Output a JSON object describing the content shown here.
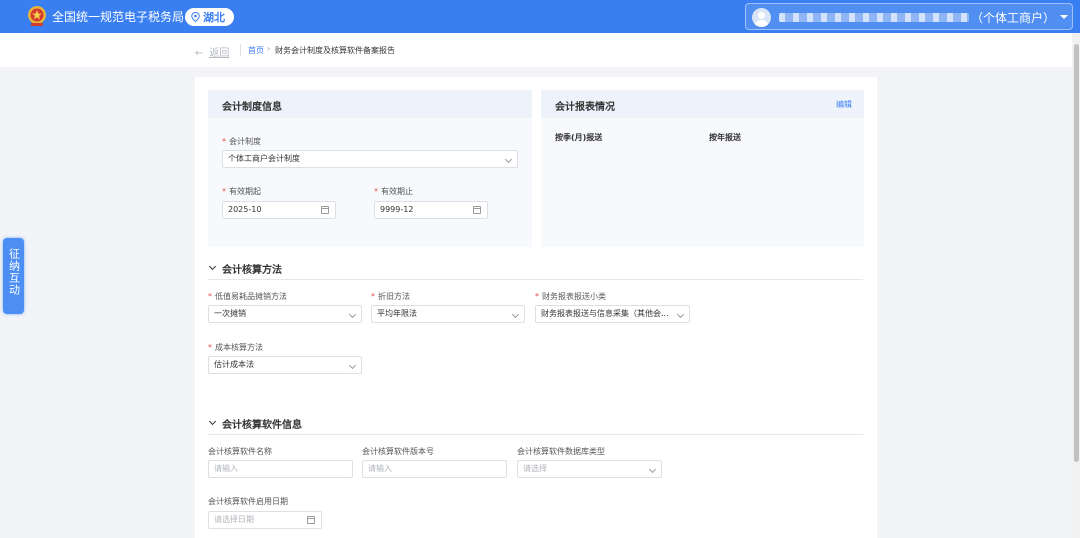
{
  "header": {
    "site_title": "全国统一规范电子税务局",
    "region": "湖北",
    "user_type": "（个体工商户）",
    "icons": [
      "emblem-logo",
      "location-pin-icon",
      "user-avatar-icon",
      "caret-down-icon"
    ]
  },
  "breadcrumb": {
    "back_label": "返回",
    "home": "首页",
    "separator": "›",
    "current": "财务会计制度及核算软件备案报告"
  },
  "float_tab": {
    "label": "征纳互动"
  },
  "accounting_system": {
    "title": "会计制度信息",
    "system_label": "会计制度",
    "system_value": "个体工商户会计制度",
    "start_label": "有效期起",
    "start_value": "2025-10",
    "end_label": "有效期止",
    "end_value": "9999-12"
  },
  "report_status": {
    "title": "会计报表情况",
    "edit_label": "编辑",
    "col_monthly": "按季(月)报送",
    "col_yearly": "按年报送"
  },
  "accounting_method": {
    "title": "会计核算方法",
    "low_value_label": "低值易耗品摊销方法",
    "low_value_value": "一次摊销",
    "depreciation_label": "折旧方法",
    "depreciation_value": "平均年限法",
    "report_sub_label": "财务报表报送小类",
    "report_sub_value": "财务报表报送与信息采集（其他会...",
    "cost_label": "成本核算方法",
    "cost_value": "估计成本法"
  },
  "software_info": {
    "title": "会计核算软件信息",
    "name_label": "会计核算软件名称",
    "name_placeholder": "请输入",
    "version_label": "会计核算软件版本号",
    "version_placeholder": "请输入",
    "db_label": "会计核算软件数据库类型",
    "db_placeholder": "请选择",
    "date_label": "会计核算软件启用日期",
    "date_placeholder": "请选择日期"
  },
  "colors": {
    "brand_blue": "#3a7ff1",
    "required_red": "#e34d4d",
    "panel_head": "#eef3fb"
  }
}
